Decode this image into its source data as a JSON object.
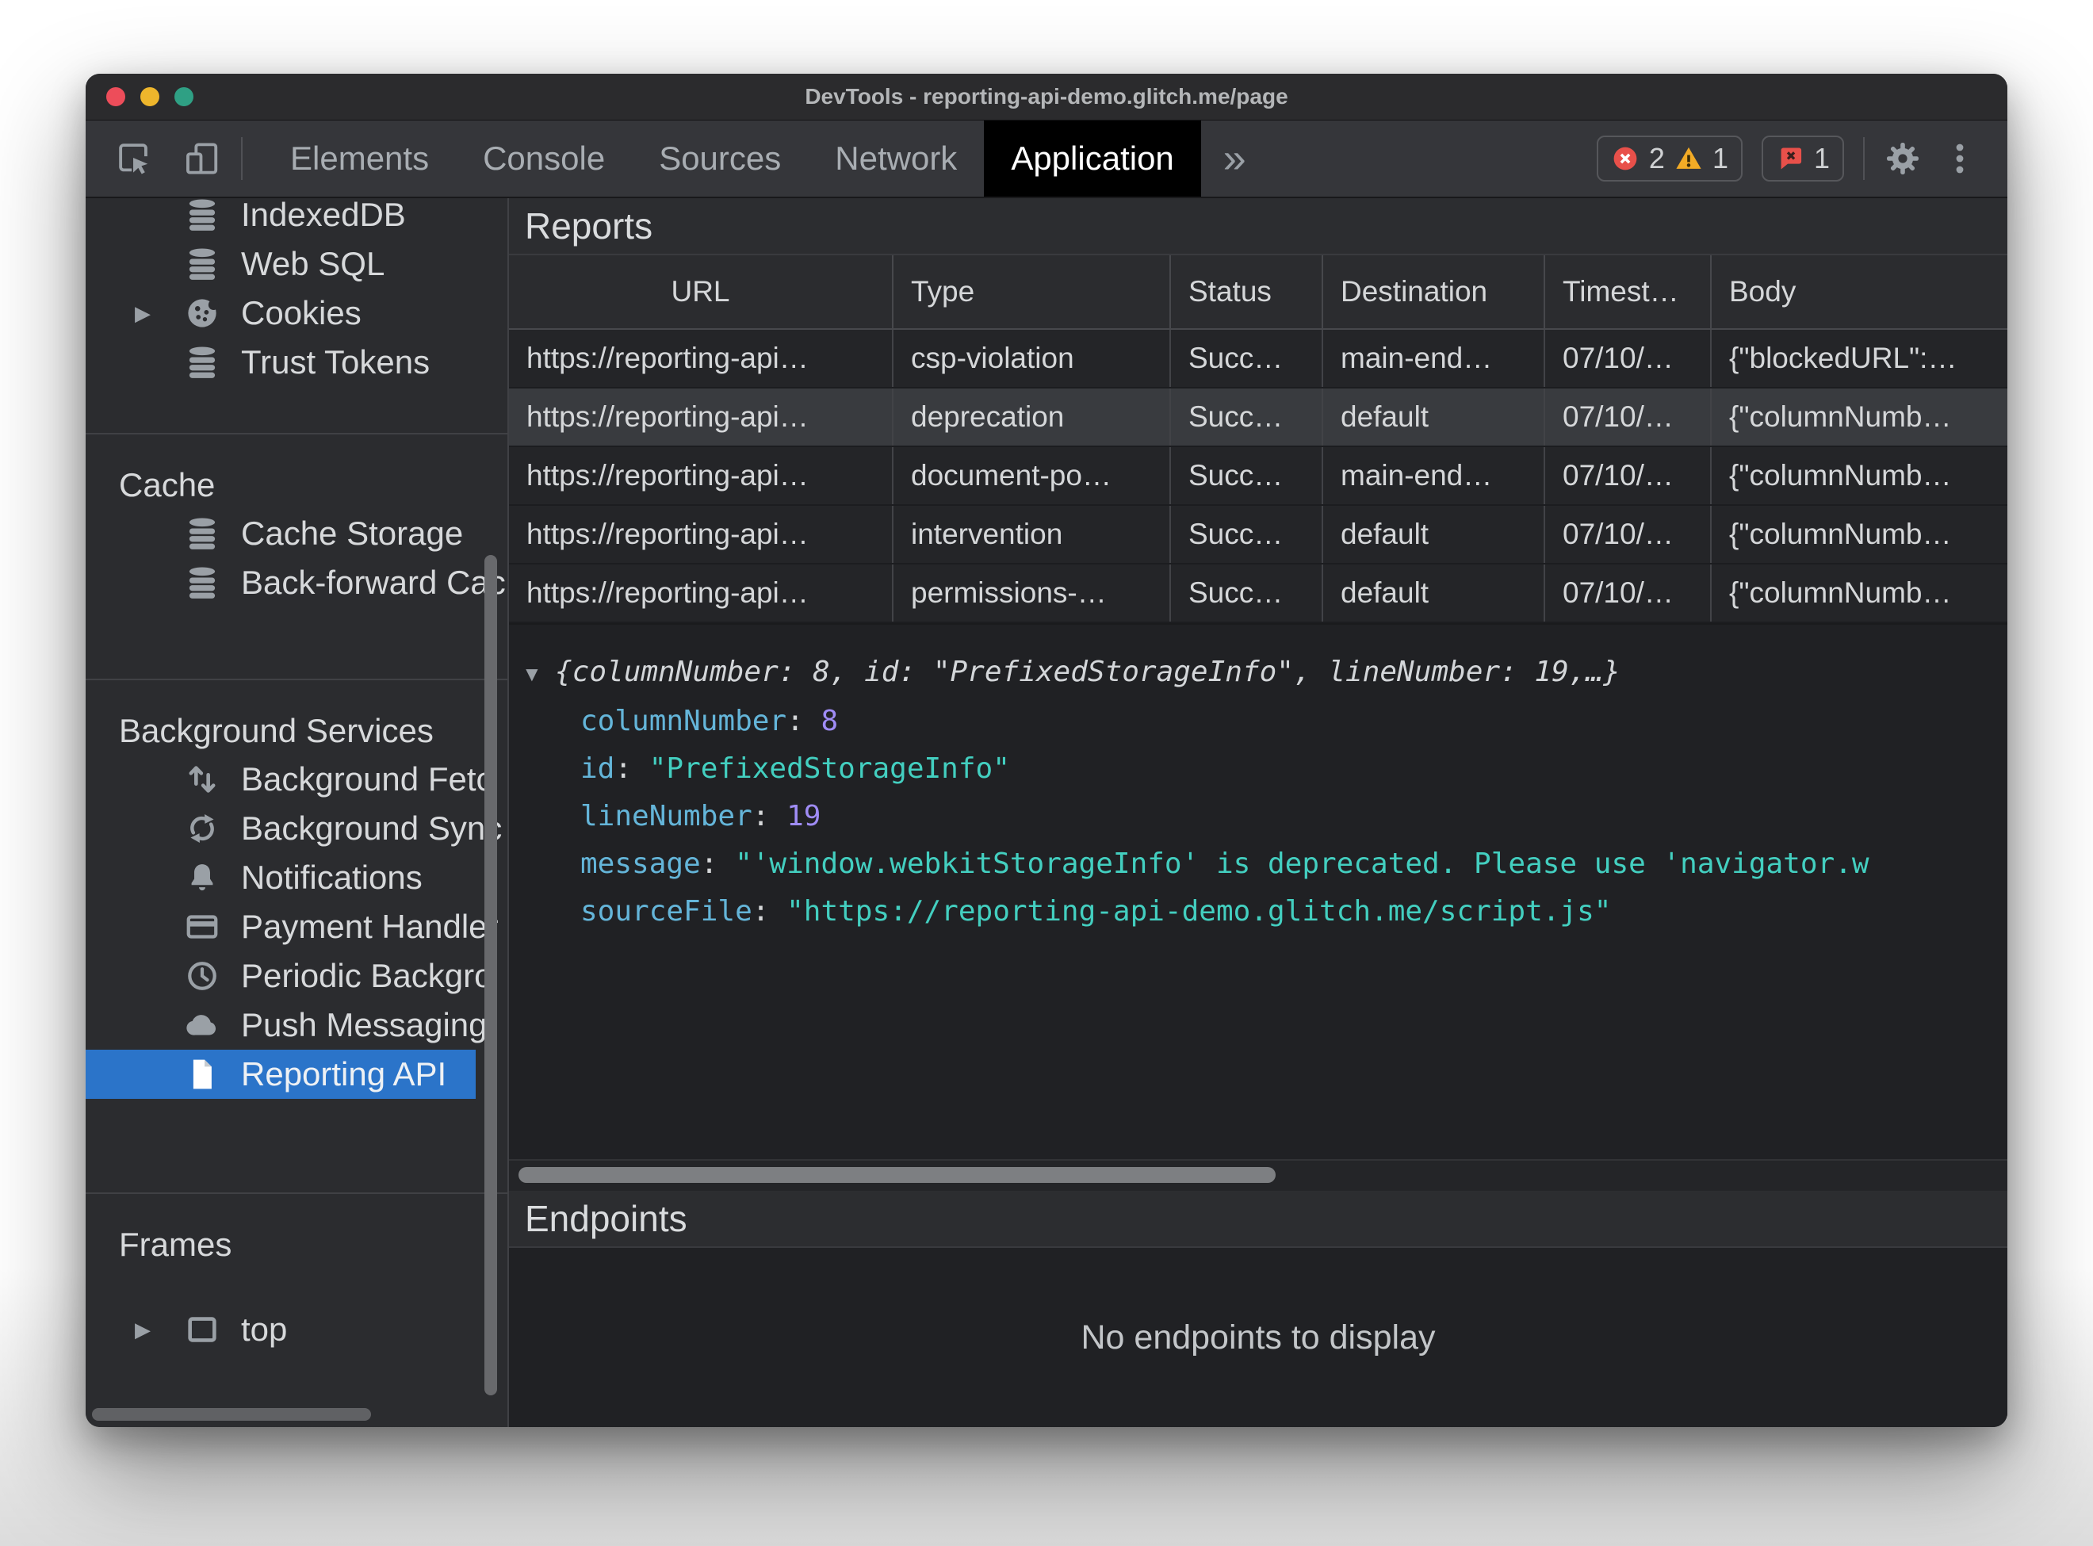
{
  "window": {
    "title": "DevTools - reporting-api-demo.glitch.me/page"
  },
  "toolbar": {
    "tabs": [
      {
        "label": "Elements"
      },
      {
        "label": "Console"
      },
      {
        "label": "Sources"
      },
      {
        "label": "Network"
      },
      {
        "label": "Application",
        "selected": true
      }
    ],
    "more_tabs_glyph": "»",
    "error_count": "2",
    "warning_count": "1",
    "issue_count": "1",
    "icons": [
      "inspect-icon",
      "device-toolbar-icon",
      "error-icon",
      "warning-icon",
      "issues-icon",
      "settings-gear-icon",
      "kebab-menu-icon"
    ]
  },
  "sidebar": {
    "storage_items": [
      {
        "label": "IndexedDB",
        "icon": "database-icon"
      },
      {
        "label": "Web SQL",
        "icon": "database-icon"
      },
      {
        "label": "Cookies",
        "icon": "cookie-icon",
        "expander": "▶"
      },
      {
        "label": "Trust Tokens",
        "icon": "database-icon"
      }
    ],
    "cache": {
      "header": "Cache",
      "items": [
        {
          "label": "Cache Storage",
          "icon": "database-icon"
        },
        {
          "label": "Back-forward Cac",
          "icon": "database-icon"
        }
      ]
    },
    "background_services": {
      "header": "Background Services",
      "items": [
        {
          "label": "Background Fetc",
          "icon": "background-fetch-icon"
        },
        {
          "label": "Background Sync",
          "icon": "background-sync-icon"
        },
        {
          "label": "Notifications",
          "icon": "bell-icon"
        },
        {
          "label": "Payment Handler",
          "icon": "payment-card-icon"
        },
        {
          "label": "Periodic Backgro",
          "icon": "clock-icon"
        },
        {
          "label": "Push Messaging",
          "icon": "cloud-icon"
        },
        {
          "label": "Reporting API",
          "icon": "document-icon",
          "selected": true
        }
      ]
    },
    "frames": {
      "header": "Frames",
      "items": [
        {
          "label": "top",
          "icon": "frame-icon",
          "expander": "▶"
        }
      ]
    }
  },
  "reports": {
    "title": "Reports",
    "columns": [
      "URL",
      "Type",
      "Status",
      "Destination",
      "Timest…",
      "Body"
    ],
    "rows": [
      {
        "url": "https://reporting-api…",
        "type": "csp-violation",
        "status": "Succ…",
        "destination": "main-end…",
        "timestamp": "07/10/…",
        "body": "{\"blockedURL\":…"
      },
      {
        "url": "https://reporting-api…",
        "type": "deprecation",
        "status": "Succ…",
        "destination": "default",
        "timestamp": "07/10/…",
        "body": "{\"columnNumb…",
        "selected": true
      },
      {
        "url": "https://reporting-api…",
        "type": "document-po…",
        "status": "Succ…",
        "destination": "main-end…",
        "timestamp": "07/10/…",
        "body": "{\"columnNumb…"
      },
      {
        "url": "https://reporting-api…",
        "type": "intervention",
        "status": "Succ…",
        "destination": "default",
        "timestamp": "07/10/…",
        "body": "{\"columnNumb…"
      },
      {
        "url": "https://reporting-api…",
        "type": "permissions-…",
        "status": "Succ…",
        "destination": "default",
        "timestamp": "07/10/…",
        "body": "{\"columnNumb…"
      }
    ]
  },
  "report_detail": {
    "expander": "▼",
    "preview": "{columnNumber: 8, id: \"PrefixedStorageInfo\", lineNumber: 19,…}",
    "kv_separator": ": ",
    "entries": [
      {
        "key": "columnNumber",
        "value": "8",
        "value_type": "number"
      },
      {
        "key": "id",
        "value": "\"PrefixedStorageInfo\"",
        "value_type": "string"
      },
      {
        "key": "lineNumber",
        "value": "19",
        "value_type": "number"
      },
      {
        "key": "message",
        "value": "\"'window.webkitStorageInfo' is deprecated. Please use 'navigator.w",
        "value_type": "string"
      },
      {
        "key": "sourceFile",
        "value": "\"https://reporting-api-demo.glitch.me/script.js\"",
        "value_type": "string"
      }
    ]
  },
  "endpoints": {
    "title": "Endpoints",
    "empty_message": "No endpoints to display"
  },
  "colors": {
    "selection_blue": "#2b74c9",
    "selected_row_gray": "#393b3f",
    "json_key": "#64b5d9",
    "json_string": "#43cfc0",
    "json_number": "#9f8cf5",
    "error_red": "#e8504a",
    "warning_yellow": "#f2ab26",
    "traffic_red": "#ed4d5a",
    "traffic_yellow": "#eeb62c",
    "traffic_green": "#2fa084"
  }
}
